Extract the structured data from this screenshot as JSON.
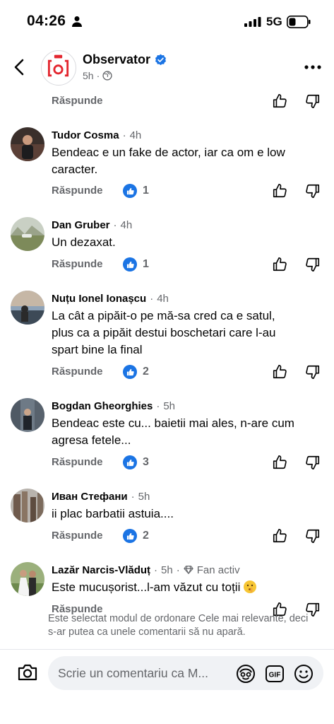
{
  "status_bar": {
    "time": "04:26",
    "network": "5G"
  },
  "header": {
    "page_name": "Observator",
    "time": "5h",
    "separator": "·"
  },
  "first_comment_actions": {
    "reply_label": "Răspunde"
  },
  "comments": [
    {
      "name": "Tudor Cosma",
      "time": "4h",
      "lines": [
        "Bendeac e un fake de actor, iar ca om e low",
        "caracter."
      ],
      "reply_label": "Răspunde",
      "likes": "1"
    },
    {
      "name": "Dan Gruber",
      "time": "4h",
      "lines": [
        "Un dezaxat."
      ],
      "reply_label": "Răspunde",
      "likes": "1"
    },
    {
      "name": "Nuțu Ionel Ionașcu",
      "time": "4h",
      "lines": [
        "La cât a pipăit-o pe mă-sa cred ca e satul,",
        "plus ca a pipăit destui boschetari care l-au",
        "spart bine la final"
      ],
      "reply_label": "Răspunde",
      "likes": "2"
    },
    {
      "name": "Bogdan Gheorghies",
      "time": "5h",
      "lines": [
        "Bendeac este cu... baietii mai ales, n-are cum",
        "agresa fetele..."
      ],
      "reply_label": "Răspunde",
      "likes": "3"
    },
    {
      "name": "Иван Стефани",
      "time": "5h",
      "lines": [
        "ii plac barbatii astuia...."
      ],
      "reply_label": "Răspunde",
      "likes": "2"
    },
    {
      "name": "Lazăr Narcis-Vlăduț",
      "time": "5h",
      "badge": "Fan activ",
      "lines": [
        "Este mucușorist...l-am văzut cu toții"
      ],
      "reply_label": "Răspunde",
      "likes": ""
    }
  ],
  "notice": "Este selectat modul de ordonare Cele mai relevante, deci s-ar putea ca unele comentarii să nu apară.",
  "composer": {
    "placeholder": "Scrie un comentariu ca M..."
  },
  "colors": {
    "accent": "#1b74e4",
    "muted": "#65676b",
    "brand_red": "#e3262f"
  },
  "icons": [
    "back-arrow-icon",
    "verified-icon",
    "globe-icon",
    "more-icon",
    "thumb-up-icon",
    "thumb-down-icon",
    "like-icon",
    "diamond-icon",
    "camera-icon",
    "avatar-sticker-icon",
    "gif-icon",
    "emoji-icon"
  ]
}
